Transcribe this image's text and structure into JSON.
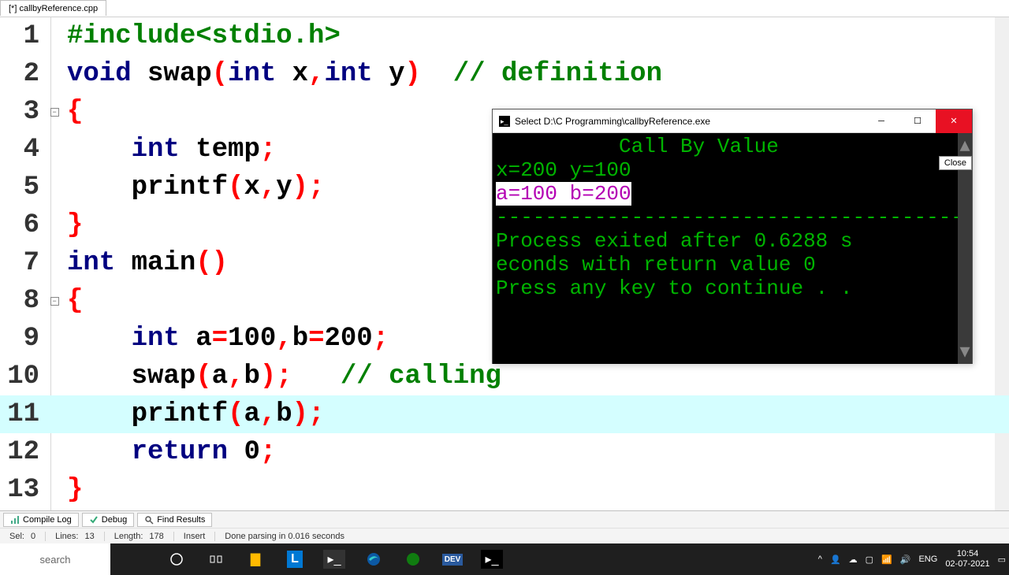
{
  "file_tab": "[*] callbyReference.cpp",
  "code_lines": [
    {
      "n": "1",
      "fold": "",
      "segs": [
        [
          "#include<stdio.h>",
          "k-green"
        ]
      ]
    },
    {
      "n": "2",
      "fold": "",
      "segs": [
        [
          "void",
          "k-navy"
        ],
        [
          " swap",
          "k-black"
        ],
        [
          "(",
          "k-red"
        ],
        [
          "int",
          "k-navy"
        ],
        [
          " x",
          "k-black"
        ],
        [
          ",",
          "k-red"
        ],
        [
          "int",
          "k-navy"
        ],
        [
          " y",
          "k-black"
        ],
        [
          ")",
          "k-red"
        ],
        [
          "  ",
          "k-black"
        ],
        [
          "// definition",
          "k-green"
        ]
      ]
    },
    {
      "n": "3",
      "fold": "-",
      "segs": [
        [
          "{",
          "k-red"
        ]
      ]
    },
    {
      "n": "4",
      "fold": "",
      "segs": [
        [
          "    ",
          "k-black"
        ],
        [
          "int",
          "k-navy"
        ],
        [
          " temp",
          "k-black"
        ],
        [
          ";",
          "k-red"
        ]
      ]
    },
    {
      "n": "5",
      "fold": "",
      "segs": [
        [
          "    printf",
          "k-black"
        ],
        [
          "(",
          "k-red"
        ],
        [
          "x",
          "k-black"
        ],
        [
          ",",
          "k-red"
        ],
        [
          "y",
          "k-black"
        ],
        [
          ");",
          "k-red"
        ]
      ]
    },
    {
      "n": "6",
      "fold": "",
      "segs": [
        [
          "}",
          "k-red"
        ]
      ]
    },
    {
      "n": "7",
      "fold": "",
      "segs": [
        [
          "int",
          "k-navy"
        ],
        [
          " main",
          "k-black"
        ],
        [
          "()",
          "k-red"
        ]
      ]
    },
    {
      "n": "8",
      "fold": "-",
      "segs": [
        [
          "{",
          "k-red"
        ]
      ]
    },
    {
      "n": "9",
      "fold": "",
      "segs": [
        [
          "    ",
          "k-black"
        ],
        [
          "int",
          "k-navy"
        ],
        [
          " a",
          "k-black"
        ],
        [
          "=",
          "k-red"
        ],
        [
          "100",
          "k-black"
        ],
        [
          ",",
          "k-red"
        ],
        [
          "b",
          "k-black"
        ],
        [
          "=",
          "k-red"
        ],
        [
          "200",
          "k-black"
        ],
        [
          ";",
          "k-red"
        ]
      ]
    },
    {
      "n": "10",
      "fold": "",
      "segs": [
        [
          "    swap",
          "k-black"
        ],
        [
          "(",
          "k-red"
        ],
        [
          "a",
          "k-black"
        ],
        [
          ",",
          "k-red"
        ],
        [
          "b",
          "k-black"
        ],
        [
          ");",
          "k-red"
        ],
        [
          "   ",
          "k-black"
        ],
        [
          "// calling",
          "k-green"
        ]
      ]
    },
    {
      "n": "11",
      "fold": "",
      "hl": true,
      "segs": [
        [
          "    printf",
          "k-black"
        ],
        [
          "(",
          "k-red"
        ],
        [
          "a",
          "k-black"
        ],
        [
          ",",
          "k-red"
        ],
        [
          "b",
          "k-black"
        ],
        [
          ");",
          "k-red"
        ]
      ]
    },
    {
      "n": "12",
      "fold": "",
      "segs": [
        [
          "    ",
          "k-black"
        ],
        [
          "return",
          "k-navy"
        ],
        [
          " ",
          "k-black"
        ],
        [
          "0",
          "k-black"
        ],
        [
          ";",
          "k-red"
        ]
      ]
    },
    {
      "n": "13",
      "fold": "",
      "segs": [
        [
          "}",
          "k-red"
        ]
      ]
    }
  ],
  "bottom_tabs": {
    "compile": "Compile Log",
    "debug": "Debug",
    "find": "Find Results"
  },
  "status": {
    "sel_label": "Sel:",
    "sel_val": "0",
    "lines_label": "Lines:",
    "lines_val": "13",
    "length_label": "Length:",
    "length_val": "178",
    "insert": "Insert",
    "parse": "Done parsing in 0.016 seconds"
  },
  "console": {
    "title": "Select D:\\C Programming\\callbyReference.exe",
    "tooltip": "Close",
    "line1_pad": "          ",
    "line1": "Call By Value",
    "line2": "x=200 y=100",
    "line3": "a=100 b=200",
    "dashes": "--------------------------------------------",
    "proc1": "Process exited after 0.6288 s",
    "proc2": "econds with return value 0",
    "press": "Press any key to continue . ."
  },
  "taskbar": {
    "search": "search",
    "lang": "ENG",
    "time": "10:54",
    "date": "02-07-2021"
  }
}
